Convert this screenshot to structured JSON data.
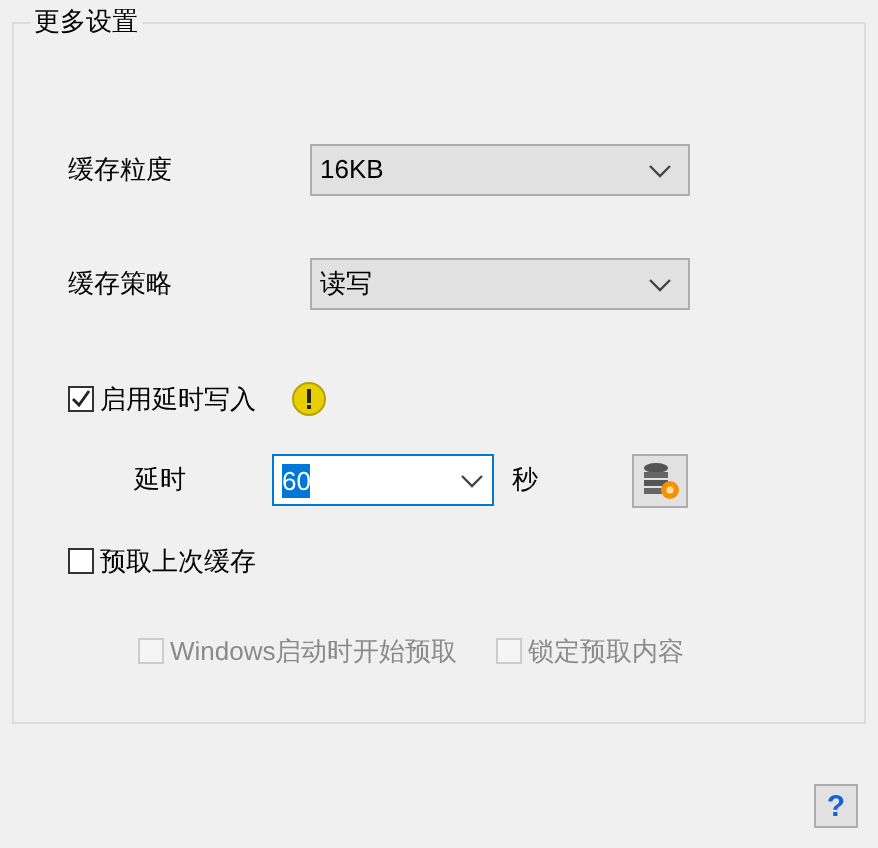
{
  "group_title": "更多设置",
  "fields": [
    {
      "label": "缓存粒度",
      "value": "16KB"
    },
    {
      "label": "缓存策略",
      "value": "读写"
    }
  ],
  "delayed_write": {
    "label": "启用延时写入",
    "checked": true
  },
  "delay": {
    "label": "延时",
    "value": "60",
    "unit": "秒"
  },
  "prefetch": {
    "label": "预取上次缓存",
    "checked": false
  },
  "sub_options": [
    {
      "label": "Windows启动时开始预取",
      "checked": false,
      "disabled": true
    },
    {
      "label": "锁定预取内容",
      "checked": false,
      "disabled": true
    }
  ],
  "help": "?"
}
